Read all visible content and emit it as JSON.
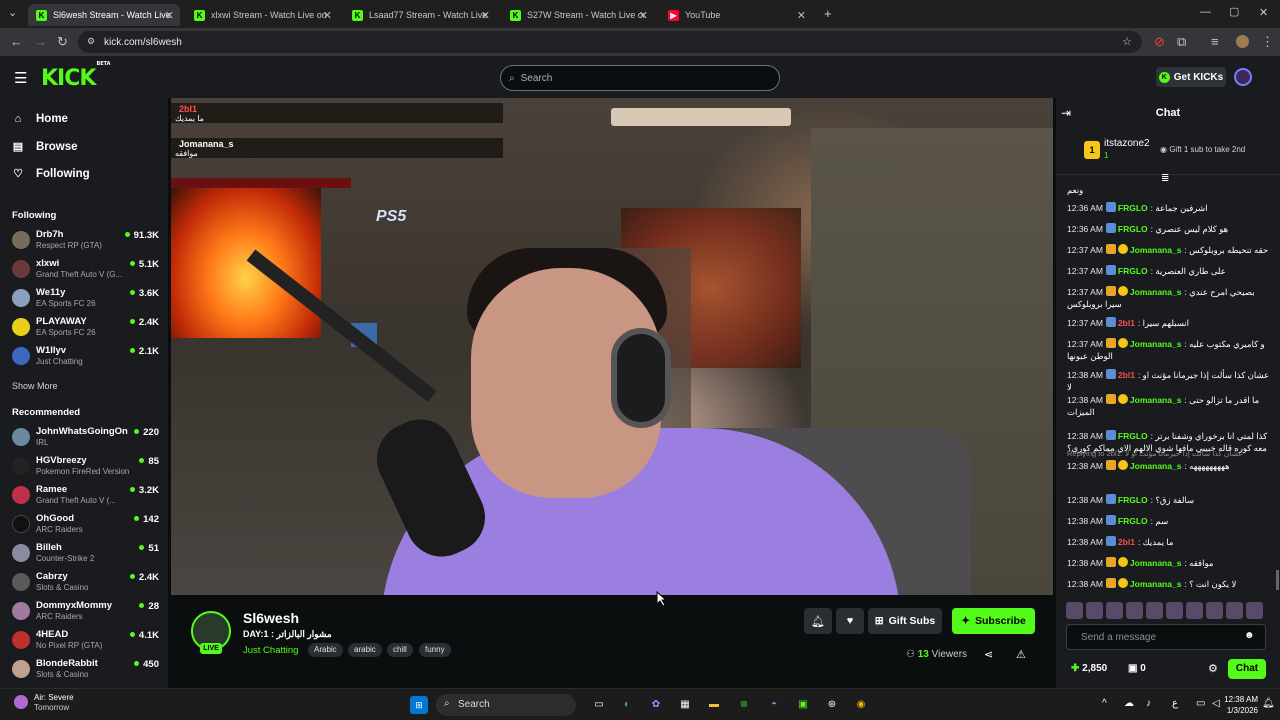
{
  "browser": {
    "tabs": [
      {
        "title": "Sl6wesh Stream - Watch Live on Kick",
        "favicon": "kick",
        "active": true
      },
      {
        "title": "xlxwi Stream - Watch Live on Kick",
        "favicon": "kick",
        "active": false
      },
      {
        "title": "Lsaad77 Stream - Watch Live on Kick",
        "favicon": "kick",
        "active": false
      },
      {
        "title": "S27W Stream - Watch Live on Kick",
        "favicon": "kick",
        "active": false
      },
      {
        "title": "YouTube",
        "favicon": "youtube",
        "active": false
      }
    ],
    "url": "kick.com/sl6wesh"
  },
  "header": {
    "logo": "KICK",
    "logo_badge": "BETA",
    "search_placeholder": "Search",
    "get_kicks": "Get KICKs"
  },
  "sidebar": {
    "nav": [
      {
        "label": "Home",
        "icon": "home-icon"
      },
      {
        "label": "Browse",
        "icon": "browse-icon"
      },
      {
        "label": "Following",
        "icon": "heart-icon"
      }
    ],
    "following_title": "Following",
    "following": [
      {
        "name": "Drb7h",
        "game": "Respect RP (GTA)",
        "viewers": "91.3K",
        "color": "#7a6a5a"
      },
      {
        "name": "xlxwi",
        "game": "Grand Theft Auto V (G...",
        "viewers": "5.1K",
        "color": "#6a3a3a"
      },
      {
        "name": "We11y",
        "game": "EA Sports FC 26",
        "viewers": "3.6K",
        "color": "#8aa0c0"
      },
      {
        "name": "PLAYAWAY",
        "game": "EA Sports FC 26",
        "viewers": "2.4K",
        "color": "#e8d018"
      },
      {
        "name": "W1llyv",
        "game": "Just Chatting",
        "viewers": "2.1K",
        "color": "#3a6ac0"
      }
    ],
    "show_more": "Show More",
    "recommended_title": "Recommended",
    "recommended": [
      {
        "name": "JohnWhatsGoingOn",
        "game": "IRL",
        "viewers": "220",
        "color": "#6a8aa0"
      },
      {
        "name": "HGVbreezy",
        "game": "Pokemon FireRed Version",
        "viewers": "85",
        "color": "#222"
      },
      {
        "name": "Ramee",
        "game": "Grand Theft Auto V (...",
        "viewers": "3.2K",
        "color": "#c0304a"
      },
      {
        "name": "OhGood",
        "game": "ARC Raiders",
        "viewers": "142",
        "color": "#111"
      },
      {
        "name": "Billeh",
        "game": "Counter-Strike 2",
        "viewers": "51",
        "color": "#8a8aa0"
      },
      {
        "name": "Cabrzy",
        "game": "Slots & Casino",
        "viewers": "2.4K",
        "color": "#5a5a5a"
      },
      {
        "name": "DommyxMommy",
        "game": "ARC Raiders",
        "viewers": "28",
        "color": "#a07aa0"
      },
      {
        "name": "4HEAD",
        "game": "No Pixel RP (GTA)",
        "viewers": "4.1K",
        "color": "#c03030"
      },
      {
        "name": "BlondeRabbit",
        "game": "Slots & Casino",
        "viewers": "450",
        "color": "#c0a090"
      }
    ]
  },
  "video_overlay": [
    {
      "user": "2bl1",
      "message": "ما يمديك",
      "color": "#ff4d4d"
    },
    {
      "user": "Jomanana_s",
      "message": "موافقه",
      "color": "#ffffff"
    }
  ],
  "stream": {
    "channel": "Sl6wesh",
    "live_label": "LIVE",
    "title": "DAY:1 : مشوار البالزاتر",
    "category": "Just Chatting",
    "tags": [
      "Arabic",
      "arabic",
      "chill",
      "funny"
    ],
    "gift_subs": "Gift Subs",
    "subscribe": "Subscribe",
    "viewers_count": "13",
    "viewers_label": "Viewers"
  },
  "chat": {
    "title": "Chat",
    "leader_rank": "1",
    "leader_name": "itstazone2",
    "leader_count": "1",
    "gift_prompt": "Gift 1 sub to take 2nd",
    "messages": [
      {
        "time": "",
        "user": "",
        "text": "ونعم",
        "color": "#fff",
        "badges": []
      },
      {
        "time": "12:36 AM",
        "user": "FRGLO",
        "text": "اشرفين جماعة",
        "color": "#53fc18",
        "badges": [
          "b1"
        ]
      },
      {
        "time": "12:36 AM",
        "user": "FRGLO",
        "text": "هو كلام ليس عنصري",
        "color": "#53fc18",
        "badges": [
          "b1"
        ]
      },
      {
        "time": "12:37 AM",
        "user": "Jomanana_s",
        "text": "حقه تنحيطه بروبلوكس",
        "color": "#53fc18",
        "badges": [
          "b2",
          "b3"
        ]
      },
      {
        "time": "12:37 AM",
        "user": "FRGLO",
        "text": "على طاري العنصرية",
        "color": "#53fc18",
        "badges": [
          "b1"
        ]
      },
      {
        "time": "12:37 AM",
        "user": "Jomanana_s",
        "text": "بصيحي امرح عندي سيرا بروبلوكس",
        "color": "#53fc18",
        "badges": [
          "b2",
          "b3"
        ]
      },
      {
        "time": "12:37 AM",
        "user": "2bl1",
        "text": "انسبلهم سيرا",
        "color": "#ff4d4d",
        "badges": [
          "b1"
        ]
      },
      {
        "time": "12:37 AM",
        "user": "Jomanana_s",
        "text": "و كاميري مكتوب عليه الوطن عبونها",
        "color": "#53fc18",
        "badges": [
          "b2",
          "b3"
        ]
      },
      {
        "time": "12:38 AM",
        "user": "2bl1",
        "text": "عشان كذا سألت إذا جيرمانا مؤنث او لا",
        "color": "#ff4d4d",
        "badges": [
          "b1"
        ]
      },
      {
        "time": "12:38 AM",
        "user": "Jomanana_s",
        "text": "ما اقدر ما تزالو حتى الميزات",
        "color": "#53fc18",
        "badges": [
          "b2",
          "b3"
        ]
      },
      {
        "time": "12:38 AM",
        "user": "FRGLO",
        "text": "كذا لمتي انا برخوراي وشفنا برتر معه كوره قاله خبيبي مافها شوي الالهم الاي مماكم كورى؟",
        "color": "#53fc18",
        "badges": [
          "b1"
        ]
      },
      {
        "time": "12:38 AM",
        "user": "Jomanana_s",
        "text": "هههههههههه",
        "color": "#53fc18",
        "badges": [
          "b2",
          "b3"
        ],
        "reply": "Replying to 2bl1: عشان كذا سألت إذا جيرمانا مؤنث او لا"
      },
      {
        "time": "12:38 AM",
        "user": "FRGLO",
        "text": "سالفة زق؟",
        "color": "#53fc18",
        "badges": [
          "b1"
        ]
      },
      {
        "time": "12:38 AM",
        "user": "FRGLO",
        "text": "سم",
        "color": "#53fc18",
        "badges": [
          "b1"
        ]
      },
      {
        "time": "12:38 AM",
        "user": "2bl1",
        "text": "ما يمديك",
        "color": "#ff4d4d",
        "badges": [
          "b1"
        ]
      },
      {
        "time": "12:38 AM",
        "user": "Jomanana_s",
        "text": "موافقه",
        "color": "#53fc18",
        "badges": [
          "b2",
          "b3"
        ]
      },
      {
        "time": "12:38 AM",
        "user": "Jomanana_s",
        "text": "لا يكون انت ؟",
        "color": "#53fc18",
        "badges": [
          "b2",
          "b3"
        ]
      }
    ],
    "input_placeholder": "Send a message",
    "kicks_balance": "2,850",
    "gifts_balance": "0",
    "send_button": "Chat"
  },
  "taskbar": {
    "weather_title": "Air: Severe",
    "weather_sub": "Tomorrow",
    "search": "Search",
    "time": "12:38 AM",
    "date": "1/3/2026"
  },
  "colors": {
    "accent": "#53fc18",
    "background": "#0b0e0f",
    "panel": "#191b1f"
  }
}
